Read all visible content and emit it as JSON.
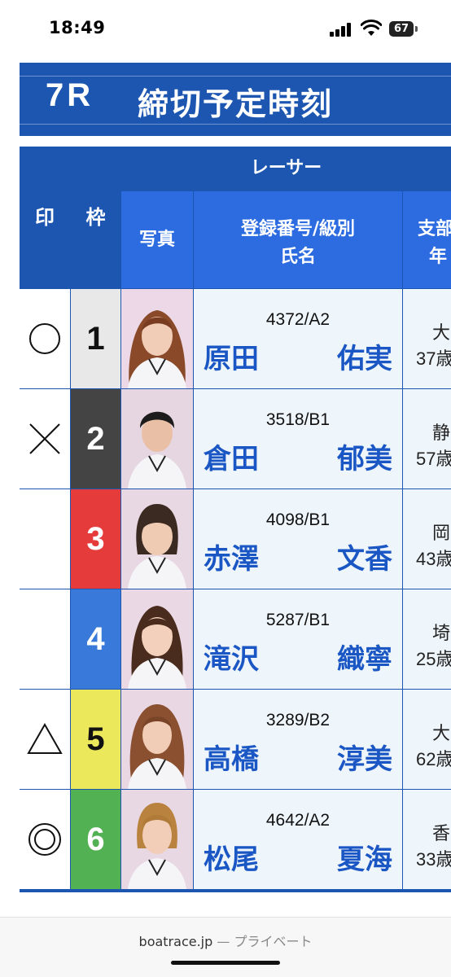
{
  "status_bar": {
    "time": "18:49",
    "battery": "67"
  },
  "race": {
    "number": "7R",
    "title": "締切予定時刻"
  },
  "table": {
    "headers": {
      "mark": "印",
      "frame": "枠",
      "racer": "レーサー",
      "photo": "写真",
      "reg_line1": "登録番号/級別",
      "reg_line2": "氏名",
      "branch_line1": "支部",
      "branch_line2": "年"
    },
    "rows": [
      {
        "mark": "○",
        "frame": "1",
        "frame_color": "#e8e8e8",
        "frame_text_color": "#111111",
        "reg": "4372/A2",
        "surname": "原田",
        "given": "佑実",
        "branch": "大",
        "age": "37歳"
      },
      {
        "mark": "×",
        "frame": "2",
        "frame_color": "#444444",
        "frame_text_color": "#ffffff",
        "reg": "3518/B1",
        "surname": "倉田",
        "given": "郁美",
        "branch": "静",
        "age": "57歳"
      },
      {
        "mark": "",
        "frame": "3",
        "frame_color": "#e63b3b",
        "frame_text_color": "#ffffff",
        "reg": "4098/B1",
        "surname": "赤澤",
        "given": "文香",
        "branch": "岡",
        "age": "43歳"
      },
      {
        "mark": "",
        "frame": "4",
        "frame_color": "#3879d9",
        "frame_text_color": "#ffffff",
        "reg": "5287/B1",
        "surname": "滝沢",
        "given": "織寧",
        "branch": "埼",
        "age": "25歳"
      },
      {
        "mark": "△",
        "frame": "5",
        "frame_color": "#ece85b",
        "frame_text_color": "#111111",
        "reg": "3289/B2",
        "surname": "高橋",
        "given": "淳美",
        "branch": "大",
        "age": "62歳"
      },
      {
        "mark": "◎",
        "frame": "6",
        "frame_color": "#52b153",
        "frame_text_color": "#ffffff",
        "reg": "4642/A2",
        "surname": "松尾",
        "given": "夏海",
        "branch": "香",
        "age": "33歳"
      }
    ]
  },
  "footer": {
    "domain": "boatrace.jp",
    "suffix": "— プライベート"
  },
  "colors": {
    "header_blue": "#1d56b1",
    "subheader_blue": "#2d6ce0",
    "link_blue": "#1b57c4",
    "row_bg": "#eef5fb"
  }
}
